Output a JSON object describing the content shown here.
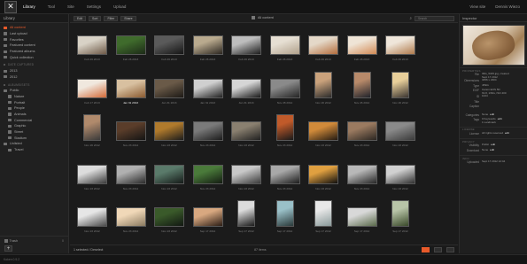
{
  "app": {
    "logo_glyph": "✕",
    "nav": [
      "Library",
      "Tool",
      "Site",
      "Settings",
      "Upload"
    ],
    "nav_active": 0,
    "right": [
      "View site",
      "Dennis Wiezo"
    ]
  },
  "sidebar": {
    "title": "Library",
    "items": [
      {
        "label": "All content",
        "kind": "item",
        "selected": true,
        "icon": "grid-icon"
      },
      {
        "label": "Last upload",
        "kind": "item",
        "icon": "upload-icon"
      },
      {
        "label": "Favorites",
        "kind": "item",
        "icon": "star-icon"
      },
      {
        "label": "Featured content",
        "kind": "item",
        "icon": "featured-icon"
      },
      {
        "label": "Featured albums",
        "kind": "item",
        "icon": "album-icon"
      },
      {
        "label": "Quick collection",
        "kind": "item",
        "icon": "collection-icon"
      },
      {
        "label": "DATE CAPTURED",
        "kind": "section"
      },
      {
        "label": "2013",
        "kind": "item",
        "icon": "calendar-icon"
      },
      {
        "label": "2012",
        "kind": "item",
        "icon": "calendar-icon"
      },
      {
        "label": "ALBUMS/SETS",
        "kind": "section"
      },
      {
        "label": "Public",
        "kind": "item",
        "icon": "folder-icon"
      },
      {
        "label": "Nature",
        "kind": "item",
        "indent": true,
        "icon": "album-icon"
      },
      {
        "label": "Portrait",
        "kind": "item",
        "indent": true,
        "icon": "album-icon"
      },
      {
        "label": "People",
        "kind": "item",
        "indent": true,
        "icon": "album-icon"
      },
      {
        "label": "Animals",
        "kind": "item",
        "indent": true,
        "icon": "album-icon"
      },
      {
        "label": "Commercial",
        "kind": "item",
        "indent": true,
        "icon": "album-icon"
      },
      {
        "label": "Graphic",
        "kind": "item",
        "indent": true,
        "icon": "album-icon"
      },
      {
        "label": "Street",
        "kind": "item",
        "indent": true,
        "icon": "album-icon"
      },
      {
        "label": "Stadium",
        "kind": "item",
        "indent": true,
        "icon": "album-icon"
      },
      {
        "label": "Unlisted",
        "kind": "item",
        "icon": "folder-icon"
      },
      {
        "label": "Travel",
        "kind": "item",
        "indent": true,
        "icon": "album-icon"
      }
    ],
    "trash_label": "Trash",
    "trash_count": "0",
    "add_label": "+"
  },
  "toolbar": {
    "buttons": [
      "Edit",
      "Sort",
      "Filter",
      "Share"
    ],
    "center_label": "All content",
    "search_placeholder": "Search"
  },
  "grid": {
    "rows": [
      [
        {
          "caption": "Feb 26 2013",
          "shape": "land",
          "c1": "#d8d2c6",
          "c2": "#6e5a48"
        },
        {
          "caption": "Feb 26 2013",
          "shape": "land",
          "c1": "#3f6b2c",
          "c2": "#1d2b18"
        },
        {
          "caption": "Feb 26 2013",
          "shape": "land",
          "c1": "#5a5a5a",
          "c2": "#151515"
        },
        {
          "caption": "Feb 26 2013",
          "shape": "land",
          "c1": "#b9aa8e",
          "c2": "#2b2620"
        },
        {
          "caption": "Feb 26 2013",
          "shape": "land",
          "c1": "#bdbdbd",
          "c2": "#1c1c1c"
        },
        {
          "caption": "Feb 26 2013",
          "shape": "land",
          "c1": "#e6dfd3",
          "c2": "#b0a08a"
        },
        {
          "caption": "Feb 26 2013",
          "shape": "land",
          "c1": "#e4d8c8",
          "c2": "#b46d3d"
        },
        {
          "caption": "Feb 26 2013",
          "shape": "land",
          "c1": "#efe4d6",
          "c2": "#d28a55"
        },
        {
          "caption": "Feb 26 2013",
          "shape": "land",
          "c1": "#efe6da",
          "c2": "#b07a4c"
        }
      ],
      [
        {
          "caption": "Feb 17 2013",
          "shape": "land",
          "c1": "#f0e8de",
          "c2": "#d36a38"
        },
        {
          "caption": "Jan 31 2013",
          "shape": "land",
          "c1": "#d8c0a0",
          "c2": "#8a5a30",
          "highlight": true
        },
        {
          "caption": "Jan 31 2013",
          "shape": "land",
          "c1": "#6a5a48",
          "c2": "#1d1a16"
        },
        {
          "caption": "Jan 31 2013",
          "shape": "land",
          "c1": "#cfcfcf",
          "c2": "#222222"
        },
        {
          "caption": "Jan 31 2013",
          "shape": "land",
          "c1": "#d5d5d5",
          "c2": "#1a1a1a"
        },
        {
          "caption": "Nov 28 2012",
          "shape": "land",
          "c1": "#8a8a8a",
          "c2": "#242424"
        },
        {
          "caption": "Nov 26 2012",
          "shape": "port",
          "c1": "#caa27c",
          "c2": "#2b2b2b"
        },
        {
          "caption": "Nov 26 2012",
          "shape": "port",
          "c1": "#b88a6a",
          "c2": "#20222a"
        },
        {
          "caption": "Nov 26 2012",
          "shape": "port",
          "c1": "#e8cf9a",
          "c2": "#3a3430"
        }
      ],
      [
        {
          "caption": "Nov 26 2012",
          "shape": "port",
          "c1": "#b08a6c",
          "c2": "#3a3a3a"
        },
        {
          "caption": "Nov 23 2012",
          "shape": "land",
          "c1": "#5a3d2a",
          "c2": "#141414"
        },
        {
          "caption": "Nov 23 2012",
          "shape": "land",
          "c1": "#b07a2c",
          "c2": "#1c1c1c"
        },
        {
          "caption": "Nov 23 2012",
          "shape": "land",
          "c1": "#7a7a7a",
          "c2": "#1c1c1c"
        },
        {
          "caption": "Nov 23 2012",
          "shape": "land",
          "c1": "#8a8070",
          "c2": "#202020"
        },
        {
          "caption": "Nov 23 2012",
          "shape": "port",
          "c1": "#c05a2a",
          "c2": "#1a1a1a"
        },
        {
          "caption": "Nov 23 2012",
          "shape": "land",
          "c1": "#d08a3a",
          "c2": "#241a12"
        },
        {
          "caption": "Nov 23 2012",
          "shape": "land",
          "c1": "#9a7a60",
          "c2": "#2a2622"
        },
        {
          "caption": "Nov 23 2012",
          "shape": "land",
          "c1": "#8a8a8a",
          "c2": "#3a3a3a"
        }
      ],
      [
        {
          "caption": "Nov 23 2012",
          "shape": "land",
          "c1": "#dcdcdc",
          "c2": "#3a3a3a"
        },
        {
          "caption": "Nov 23 2012",
          "shape": "land",
          "c1": "#b0b0b0",
          "c2": "#2a2a2a"
        },
        {
          "caption": "Nov 23 2012",
          "shape": "land",
          "c1": "#5a7a6a",
          "c2": "#151a18"
        },
        {
          "caption": "Nov 23 2012",
          "shape": "land",
          "c1": "#4a7a3a",
          "c2": "#141c12"
        },
        {
          "caption": "Nov 23 2012",
          "shape": "land",
          "c1": "#c8c8c8",
          "c2": "#3a3a3a"
        },
        {
          "caption": "Nov 23 2012",
          "shape": "land",
          "c1": "#a8a8a8",
          "c2": "#1c1c1c"
        },
        {
          "caption": "Nov 23 2012",
          "shape": "land",
          "c1": "#e0a040",
          "c2": "#0e0e0e"
        },
        {
          "caption": "Nov 23 2012",
          "shape": "land",
          "c1": "#b8b8b8",
          "c2": "#262626"
        },
        {
          "caption": "Nov 23 2012",
          "shape": "land",
          "c1": "#d0d0d0",
          "c2": "#303030"
        }
      ],
      [
        {
          "caption": "Nov 23 2012",
          "shape": "land",
          "c1": "#e6e6e6",
          "c2": "#4a4a4a"
        },
        {
          "caption": "Nov 23 2012",
          "shape": "land",
          "c1": "#f0d8b8",
          "c2": "#8a7a60"
        },
        {
          "caption": "Nov 23 2012",
          "shape": "land",
          "c1": "#3a5a2a",
          "c2": "#121812"
        },
        {
          "caption": "Sep 17 2012",
          "shape": "land",
          "c1": "#d8a880",
          "c2": "#2a1c14"
        },
        {
          "caption": "Sep 17 2012",
          "shape": "port",
          "c1": "#dcdcdc",
          "c2": "#1a1a1a"
        },
        {
          "caption": "Sep 17 2012",
          "shape": "port",
          "c1": "#9ac0c8",
          "c2": "#2a3a3a"
        },
        {
          "caption": "Sep 17 2012",
          "shape": "port",
          "c1": "#e8e8e8",
          "c2": "#8a9a9a"
        },
        {
          "caption": "Sep 17 2012",
          "shape": "land",
          "c1": "#d8d8d8",
          "c2": "#5a6a4a"
        },
        {
          "caption": "Sep 17 2012",
          "shape": "port",
          "c1": "#b8c4a8",
          "c2": "#3a4a2a"
        }
      ]
    ]
  },
  "statusbar": {
    "selection": "1 selected / Deselect",
    "count": "87 items",
    "views": [
      "grid-view",
      "list-view",
      "detail-view"
    ],
    "active_view": 0
  },
  "inspector": {
    "title": "Inspector",
    "sections": [
      {
        "title": "PROPERTIES",
        "rows": [
          {
            "k": "File",
            "v": "IMG_5345.jpg, created",
            "v2": "Sept 17 2012"
          },
          {
            "k": "Dimensions",
            "v": "3456 x 2304"
          },
          {
            "k": "Type",
            "v": "JPEG"
          },
          {
            "k": "EXIF",
            "v": "Canon EOS 5D",
            "v2": "f/2.8, 1/60s, ISO 400"
          },
          {
            "k": "ID",
            "v": "1024"
          },
          {
            "k": "Title",
            "v": ""
          },
          {
            "k": "Caption",
            "v": ""
          }
        ]
      },
      {
        "title": "",
        "rows": [
          {
            "k": "Categories",
            "v": "None",
            "edit": "edit"
          },
          {
            "k": "Tags",
            "v": "0 Keywords",
            "v2": "1 Landmark",
            "edit": "edit"
          }
        ]
      },
      {
        "title": "LICENSE",
        "rows": [
          {
            "k": "License",
            "v": "All rights reserved",
            "edit": "edit"
          }
        ]
      },
      {
        "title": "PRIVACY",
        "rows": [
          {
            "k": "Visibility",
            "v": "Public",
            "edit": "edit"
          },
          {
            "k": "Download",
            "v": "None",
            "edit": "edit"
          }
        ]
      },
      {
        "title": "INFO",
        "rows": [
          {
            "k": "Uploaded",
            "v": "Sept 17 2012 12:44"
          }
        ]
      }
    ],
    "colors": {
      "preview_light": "#efe7dc",
      "preview_dark": "#6e4b2c"
    }
  },
  "footer": {
    "text": "Koken 0.9.2"
  },
  "colors": {
    "accent": "#e85a2a",
    "bg": "#1b1b1b",
    "panel": "#202020"
  }
}
